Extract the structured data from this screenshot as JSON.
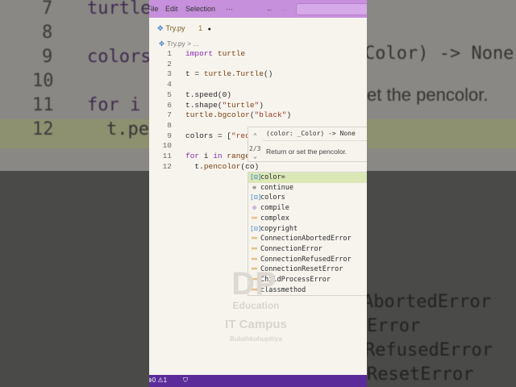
{
  "background": {
    "line_numbers": [
      "7",
      "8",
      "9",
      "10",
      "11",
      "12"
    ],
    "left_code": [
      "turtle",
      "colors",
      "for i i",
      "t.per"
    ],
    "right_text": [
      "Color) -> None",
      "et the pencolor.",
      "AbortedError",
      "Error",
      "RefusedError",
      "ResetError"
    ]
  },
  "titlebar": {
    "menu": [
      "File",
      "Edit",
      "Selection",
      "···"
    ],
    "back": "←",
    "forward": "→"
  },
  "tab": {
    "name": "Try.py",
    "problems": "1",
    "dirty": "●"
  },
  "breadcrumb": {
    "file": "Try.py",
    "sep": ">",
    "rest": "..."
  },
  "code_lines": [
    {
      "n": "1",
      "text": "import turtle"
    },
    {
      "n": "2",
      "text": ""
    },
    {
      "n": "3",
      "text": "t = turtle.Turtle()"
    },
    {
      "n": "4",
      "text": ""
    },
    {
      "n": "5",
      "text": "t.speed(0)"
    },
    {
      "n": "6",
      "text": "t.shape(\"turtle\")"
    },
    {
      "n": "7",
      "text": "turtle.bgcolor(\"black\")"
    },
    {
      "n": "8",
      "text": ""
    },
    {
      "n": "9",
      "text": "colors = [\"red\""
    },
    {
      "n": "10",
      "text": ""
    },
    {
      "n": "11",
      "text": "for i in range("
    },
    {
      "n": "12",
      "text": "  t.pencolor(co)"
    }
  ],
  "signature_hint": {
    "signature": "(color: _Color) -> None",
    "counter": "2/3",
    "up": "⌃",
    "down": "⌄",
    "doc": "Return or set the pencolor."
  },
  "suggestions": [
    {
      "label": "color=",
      "icon": "variable-icon",
      "selected": true
    },
    {
      "label": "continue",
      "icon": "keyword-icon"
    },
    {
      "label": "colors",
      "icon": "variable-icon"
    },
    {
      "label": "compile",
      "icon": "function-icon"
    },
    {
      "label": "complex",
      "icon": "class-icon"
    },
    {
      "label": "copyright",
      "icon": "variable-icon"
    },
    {
      "label": "ConnectionAbortedError",
      "icon": "class-icon"
    },
    {
      "label": "ConnectionError",
      "icon": "class-icon"
    },
    {
      "label": "ConnectionRefusedError",
      "icon": "class-icon"
    },
    {
      "label": "ConnectionResetError",
      "icon": "class-icon"
    },
    {
      "label": "ChildProcessError",
      "icon": "class-icon"
    },
    {
      "label": "classmethod",
      "icon": "class-icon"
    }
  ],
  "watermark": {
    "logo": "DP",
    "line1": "Education",
    "line2": "IT Campus",
    "line3": "Bulathkohupitiya"
  },
  "status": {
    "errors": "0",
    "warnings": "1"
  },
  "colors": {
    "titlebar": "#c690dc",
    "statusbar": "#5b2c99",
    "selected_suggestion": "#dbe8b6"
  }
}
